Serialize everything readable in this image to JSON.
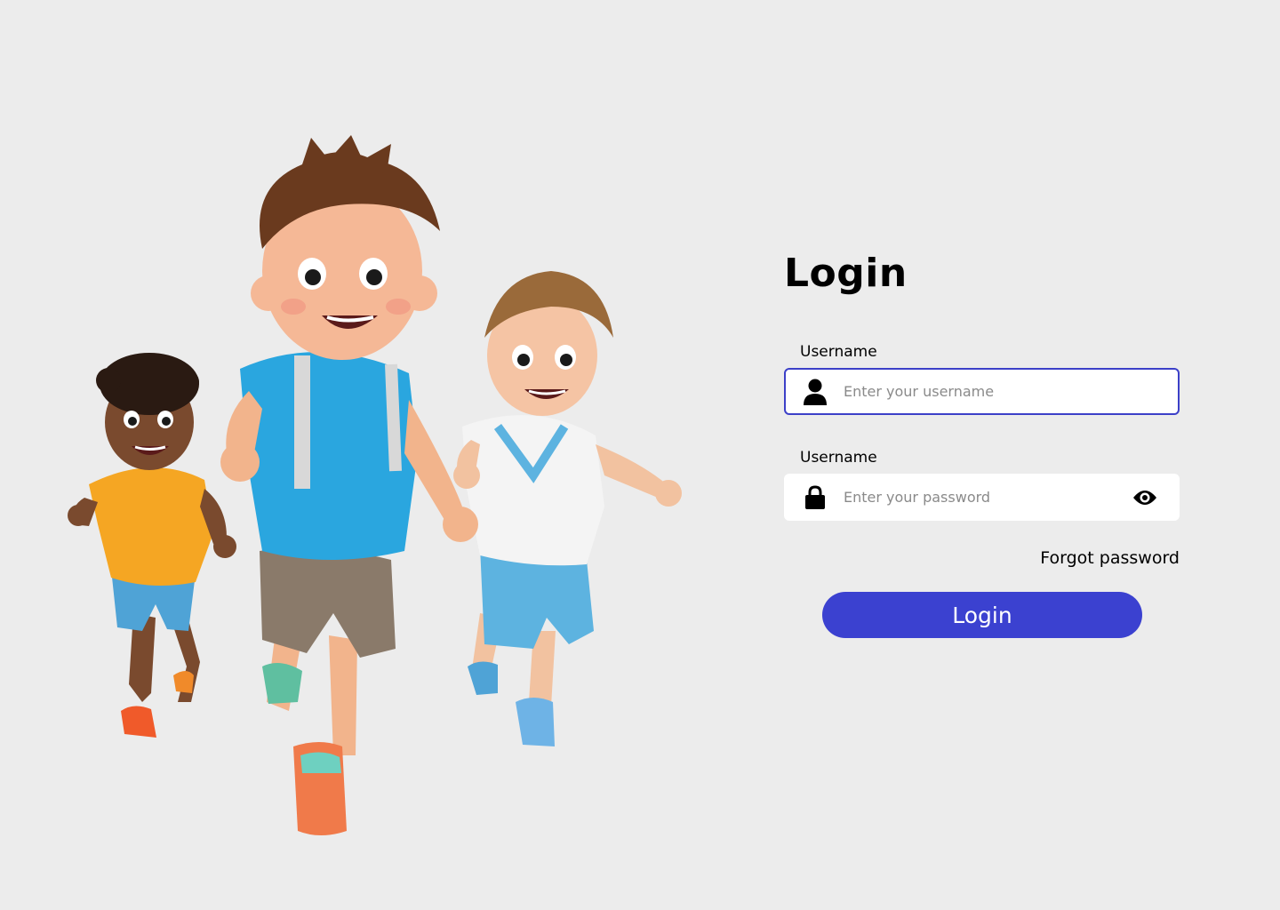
{
  "login": {
    "title": "Login",
    "username_label": "Username",
    "username_placeholder": "Enter your username",
    "password_label": "Username",
    "password_placeholder": "Enter your password",
    "forgot_link": "Forgot password",
    "submit_label": "Login"
  },
  "icons": {
    "username": "user-icon",
    "password": "lock-icon",
    "toggle_visibility": "eye-icon"
  },
  "colors": {
    "background": "#ececec",
    "accent": "#3b41d0",
    "focus_border": "#3c40c8",
    "input_background": "#ffffff"
  }
}
